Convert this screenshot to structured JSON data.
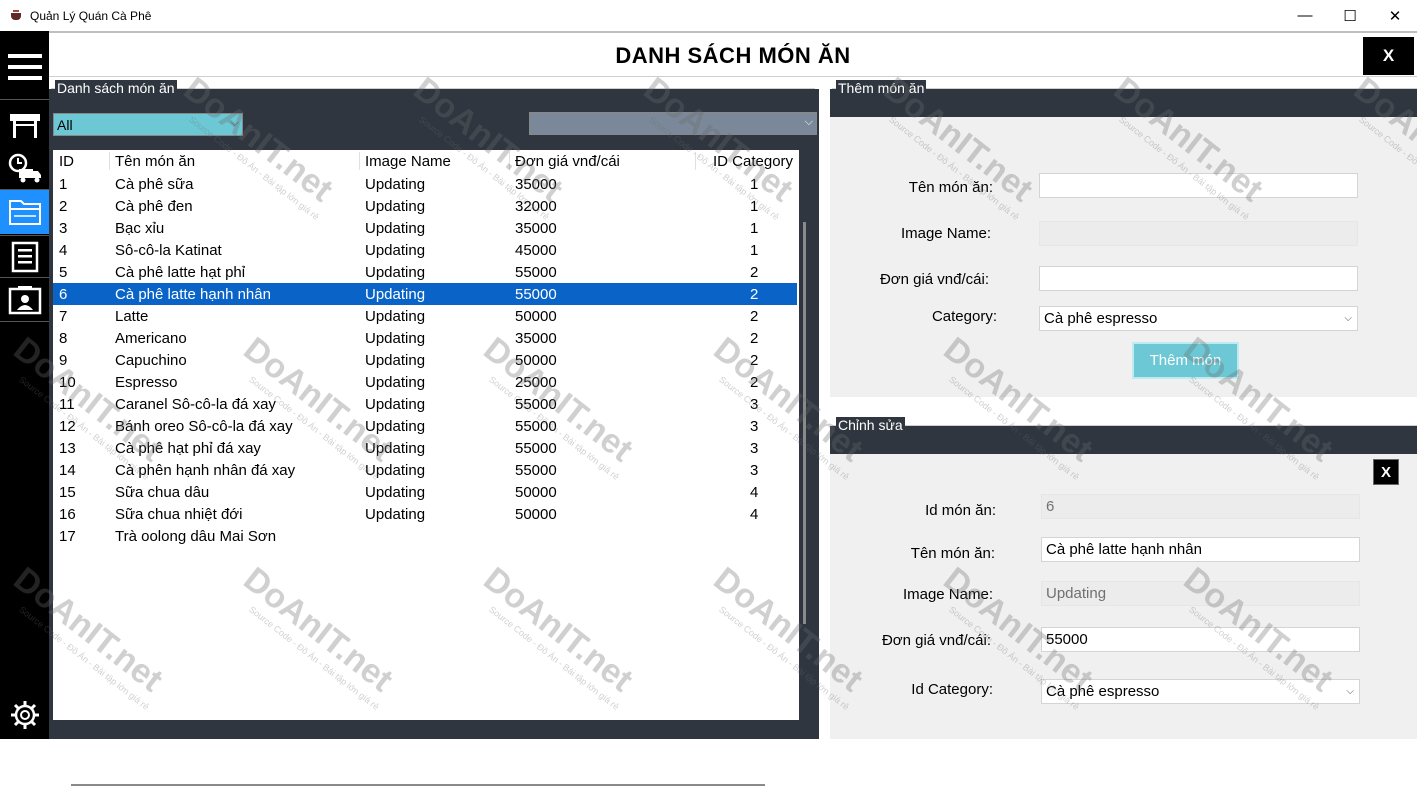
{
  "window": {
    "title": "Quản Lý Quán Cà Phê",
    "minimize": "—",
    "maximize": "☐",
    "close": "✕"
  },
  "sidebar": {
    "items": [
      {
        "name": "menu",
        "icon": "hamburger-menu-icon"
      },
      {
        "name": "store",
        "icon": "store-icon"
      },
      {
        "name": "delivery",
        "icon": "delivery-truck-icon"
      },
      {
        "name": "food-list",
        "icon": "folder-icon",
        "active": true
      },
      {
        "name": "invoice",
        "icon": "document-icon"
      },
      {
        "name": "account",
        "icon": "contact-card-icon"
      },
      {
        "name": "settings",
        "icon": "gear-icon"
      }
    ]
  },
  "header": {
    "title": "DANH SÁCH MÓN ĂN",
    "close_label": "X"
  },
  "list_panel": {
    "title": "Danh sách món ăn",
    "filter_value": "All",
    "second_filter_value": "",
    "columns": [
      "ID",
      "Tên món ăn",
      "Image Name",
      "Đơn giá vnđ/cái",
      "ID Category"
    ],
    "selected_id": "6",
    "rows": [
      {
        "id": "1",
        "name": "Cà phê sữa",
        "image": "Updating",
        "price": "35000",
        "category": "1"
      },
      {
        "id": "2",
        "name": "Cà phê đen",
        "image": "Updating",
        "price": "32000",
        "category": "1"
      },
      {
        "id": "3",
        "name": "Bạc xỉu",
        "image": "Updating",
        "price": "35000",
        "category": "1"
      },
      {
        "id": "4",
        "name": "Sô-cô-la Katinat",
        "image": "Updating",
        "price": "45000",
        "category": "1"
      },
      {
        "id": "5",
        "name": "Cà phê latte hạt phỉ",
        "image": "Updating",
        "price": "55000",
        "category": "2"
      },
      {
        "id": "6",
        "name": "Cà phê latte hạnh nhân",
        "image": "Updating",
        "price": "55000",
        "category": "2"
      },
      {
        "id": "7",
        "name": "Latte",
        "image": "Updating",
        "price": "50000",
        "category": "2"
      },
      {
        "id": "8",
        "name": "Americano",
        "image": "Updating",
        "price": "35000",
        "category": "2"
      },
      {
        "id": "9",
        "name": "Capuchino",
        "image": "Updating",
        "price": "50000",
        "category": "2"
      },
      {
        "id": "10",
        "name": "Espresso",
        "image": "Updating",
        "price": "25000",
        "category": "2"
      },
      {
        "id": "11",
        "name": "Caranel Sô-cô-la đá xay",
        "image": "Updating",
        "price": "55000",
        "category": "3"
      },
      {
        "id": "12",
        "name": "Bánh oreo Sô-cô-la đá xay",
        "image": "Updating",
        "price": "55000",
        "category": "3"
      },
      {
        "id": "13",
        "name": "Cà phê hạt phỉ đá xay",
        "image": "Updating",
        "price": "55000",
        "category": "3"
      },
      {
        "id": "14",
        "name": "Cà phên hạnh nhân đá xay",
        "image": "Updating",
        "price": "55000",
        "category": "3"
      },
      {
        "id": "15",
        "name": "Sữa chua dâu",
        "image": "Updating",
        "price": "50000",
        "category": "4"
      },
      {
        "id": "16",
        "name": "Sữa chua nhiệt đới",
        "image": "Updating",
        "price": "50000",
        "category": "4"
      },
      {
        "id": "17",
        "name": "Trà oolong dâu Mai Sơn",
        "image": "",
        "price": "",
        "category": ""
      }
    ]
  },
  "add_panel": {
    "title": "Thêm món ăn",
    "name_label": "Tên món ăn:",
    "name_value": "",
    "image_label": "Image Name:",
    "image_value": "",
    "price_label": "Đơn giá vnđ/cái:",
    "price_value": "",
    "category_label": "Category:",
    "category_value": "Cà phê espresso",
    "submit_label": "Thêm món"
  },
  "edit_panel": {
    "title": "Chỉnh sửa",
    "close_label": "X",
    "id_label": "Id món ăn:",
    "id_value": "6",
    "name_label": "Tên món ăn:",
    "name_value": "Cà phê latte hạnh nhân",
    "image_label": "Image Name:",
    "image_value": "Updating",
    "price_label": "Đơn giá vnđ/cái:",
    "price_value": "55000",
    "category_label": "Id Category:",
    "category_value": "Cà phê espresso"
  },
  "watermark": {
    "text": "DoAnIT.net",
    "subtext": "Source Code - Đồ Án - Bài tập lớn giá rẻ"
  },
  "colors": {
    "sidebar_bg": "#000000",
    "active_item": "#1e90ff",
    "panel_dark": "#2f3640",
    "selected_row": "#0a64c8",
    "filter_select": "#6cc8d4",
    "add_button": "#6cc8d4"
  }
}
